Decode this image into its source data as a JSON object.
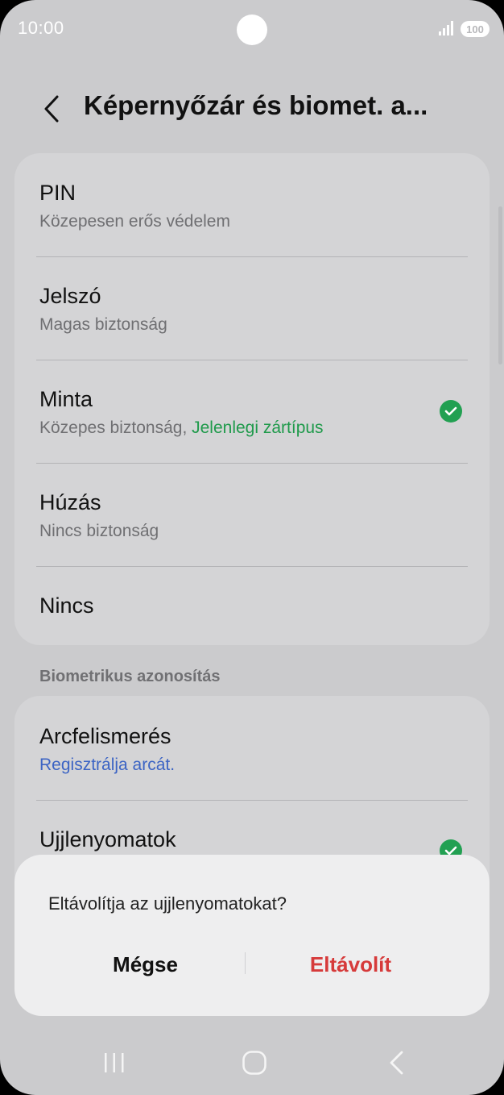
{
  "status_bar": {
    "time": "10:00",
    "battery": "100"
  },
  "header": {
    "title": "Képernyőzár és biomet. a..."
  },
  "lock_types": [
    {
      "title": "PIN",
      "subtitle": "Közepesen erős védelem"
    },
    {
      "title": "Jelszó",
      "subtitle": "Magas biztonság"
    },
    {
      "title": "Minta",
      "subtitle": "Közepes biztonság, ",
      "subtitle_accent": "Jelenlegi zártípus",
      "selected": true
    },
    {
      "title": "Húzás",
      "subtitle": "Nincs biztonság"
    },
    {
      "title": "Nincs"
    }
  ],
  "biometrics": {
    "section_label": "Biometrikus azonosítás",
    "items": [
      {
        "title": "Arcfelismerés",
        "subtitle": "Regisztrálja arcát."
      },
      {
        "title": "Ujjlenyomatok",
        "enabled": true
      }
    ]
  },
  "dialog": {
    "message": "Eltávolítja az ujjlenyomatokat?",
    "cancel_label": "Mégse",
    "confirm_label": "Eltávolít"
  },
  "colors": {
    "background": "#cbcbcd",
    "card": "#d4d4d6",
    "accent_green": "#1f9a4b",
    "link_blue": "#3c64c4",
    "destructive_red": "#d63a3a"
  },
  "icons": [
    "back-icon",
    "check-icon",
    "nav-recents-icon",
    "nav-home-icon",
    "nav-back-icon",
    "signal-icon",
    "battery-icon"
  ]
}
